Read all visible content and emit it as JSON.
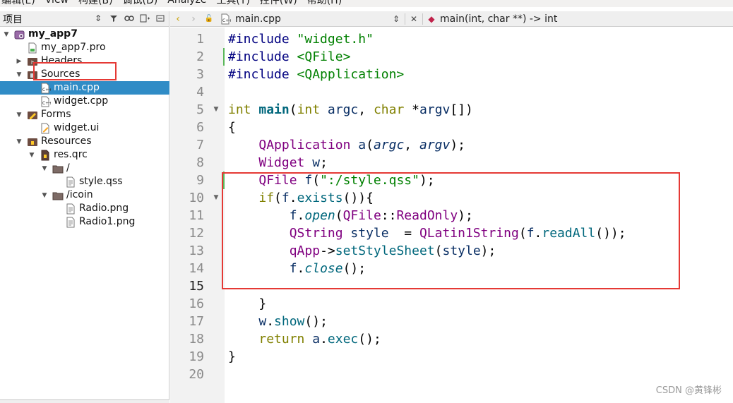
{
  "menubar": [
    "编辑(E)",
    "View",
    "构建(B)",
    "调试(D)",
    "Analyze",
    "工具(T)",
    "控件(W)",
    "帮助(H)"
  ],
  "project_panel": {
    "title": "项目",
    "tree": [
      {
        "label": "my_app7",
        "bold": true,
        "icon": "project-icon",
        "expanded": true
      },
      {
        "label": "my_app7.pro",
        "icon": "pro-file-icon"
      },
      {
        "label": "Headers",
        "icon": "headers-folder-icon",
        "expanded": false
      },
      {
        "label": "Sources",
        "icon": "sources-folder-icon",
        "expanded": true
      },
      {
        "label": "main.cpp",
        "icon": "cpp-file-icon",
        "selected": true
      },
      {
        "label": "widget.cpp",
        "icon": "cpp-file-icon"
      },
      {
        "label": "Forms",
        "icon": "forms-folder-icon",
        "expanded": true
      },
      {
        "label": "widget.ui",
        "icon": "ui-file-icon"
      },
      {
        "label": "Resources",
        "icon": "resources-folder-icon",
        "expanded": true
      },
      {
        "label": "res.qrc",
        "icon": "qrc-file-icon",
        "expanded": true
      },
      {
        "label": "/",
        "icon": "folder-icon",
        "expanded": true
      },
      {
        "label": "style.qss",
        "icon": "text-file-icon"
      },
      {
        "label": "/icoin",
        "icon": "folder-icon",
        "expanded": true
      },
      {
        "label": "Radio.png",
        "icon": "text-file-icon"
      },
      {
        "label": "Radio1.png",
        "icon": "text-file-icon"
      }
    ]
  },
  "editor": {
    "file_name": "main.cpp",
    "symbol": "main(int, char **) -> int",
    "current_line": 15,
    "line_numbers": [
      "1",
      "2",
      "3",
      "4",
      "5",
      "6",
      "7",
      "8",
      "9",
      "10",
      "11",
      "12",
      "13",
      "14",
      "15",
      "16",
      "17",
      "18",
      "19",
      "20"
    ]
  },
  "watermark": "CSDN @黄锋彬",
  "colors": {
    "selection": "#308cc6",
    "highlight_box": "#e53935",
    "keyword": "#808000",
    "string": "#008000"
  }
}
